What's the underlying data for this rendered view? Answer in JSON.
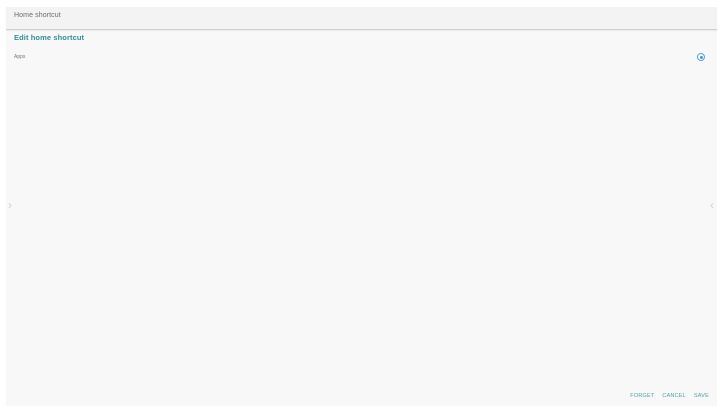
{
  "header": {
    "title": "Home shortcut"
  },
  "section": {
    "title": "Edit home shortcut"
  },
  "options": [
    {
      "label": "Apps",
      "selected": true
    }
  ],
  "actions": {
    "forget": "FORGET",
    "cancel": "CANCEL",
    "save": "SAVE"
  },
  "icons": {
    "left": "chevron-left-icon",
    "right": "chevron-right-icon",
    "radio": "radio-selected-icon"
  },
  "colors": {
    "accent": "#2f8f96",
    "radio": "#3d96d4"
  }
}
